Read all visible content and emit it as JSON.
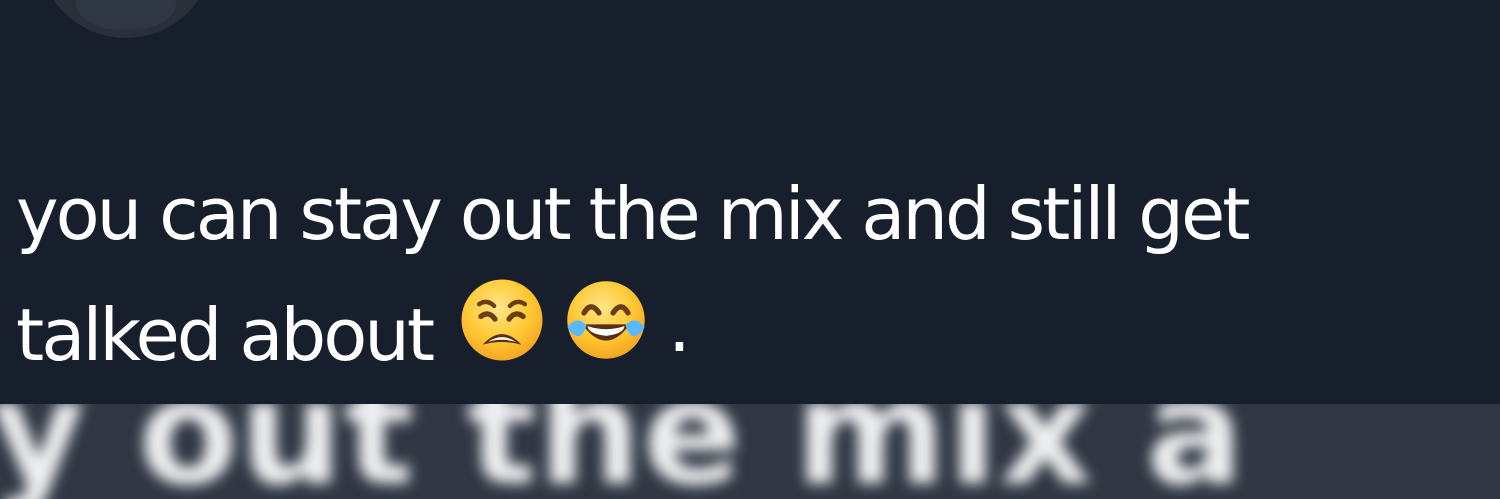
{
  "tweet": {
    "avatar_name": "user-avatar",
    "line1": "you can stay out the mix and still get",
    "line2": "talked about",
    "emoji_1": "😩",
    "emoji_2": "😂",
    "ending": ".",
    "blurred_text": "y out the mix a"
  },
  "colors": {
    "background": "#171e2c",
    "blur_band": "#303743",
    "text": "#ffffff"
  }
}
